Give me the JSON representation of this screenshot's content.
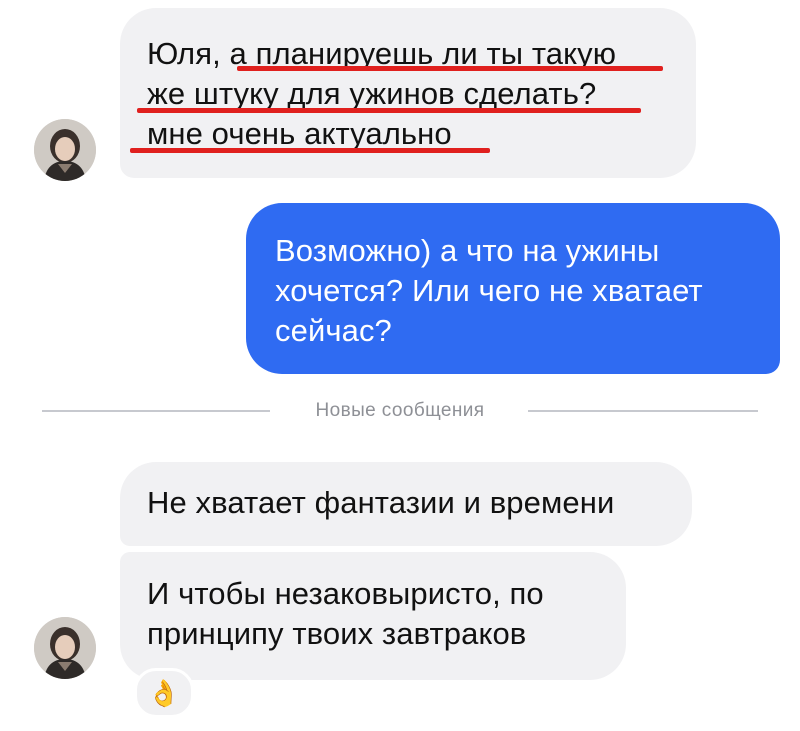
{
  "messages": [
    {
      "direction": "incoming",
      "lines": [
        "Юля, а планируешь ли ты такую",
        "же штуку для ужинов сделать?",
        "мне очень актуально"
      ]
    },
    {
      "direction": "outgoing",
      "lines": [
        "Возможно) а что на ужины",
        "хочется? Или чего не хватает",
        "сейчас?"
      ]
    },
    {
      "direction": "incoming",
      "lines": [
        "Не хватает фантазии и времени"
      ]
    },
    {
      "direction": "incoming",
      "lines": [
        "И чтобы незаковыристо, по",
        "принципу твоих завтраков"
      ],
      "reaction": "👌"
    }
  ],
  "divider": {
    "label": "Новые сообщения"
  },
  "colors": {
    "outgoing_bubble": "#2f6bf2",
    "incoming_bubble": "#f1f1f3",
    "highlight_underline": "#e0201e"
  },
  "icons": {
    "avatar": "user-avatar-photo",
    "reaction": "ok-hand-emoji"
  }
}
